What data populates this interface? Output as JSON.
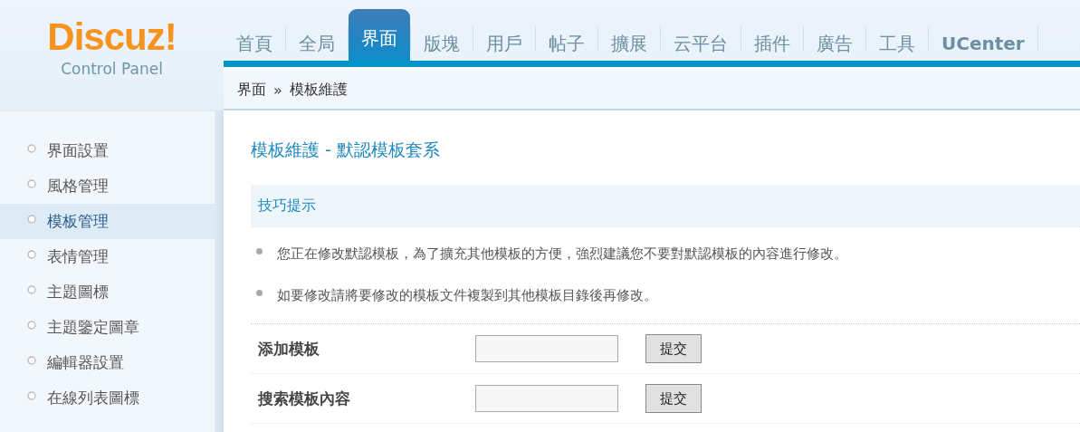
{
  "logo": {
    "brand": "Discuz!",
    "subtitle": "Control Panel"
  },
  "nav": [
    {
      "label": "首頁",
      "selected": false
    },
    {
      "label": "全局",
      "selected": false
    },
    {
      "label": "界面",
      "selected": true
    },
    {
      "label": "版塊",
      "selected": false
    },
    {
      "label": "用戶",
      "selected": false
    },
    {
      "label": "帖子",
      "selected": false
    },
    {
      "label": "擴展",
      "selected": false
    },
    {
      "label": "云平台",
      "selected": false
    },
    {
      "label": "插件",
      "selected": false
    },
    {
      "label": "廣告",
      "selected": false
    },
    {
      "label": "工具",
      "selected": false
    },
    {
      "label": "UCenter",
      "selected": false
    }
  ],
  "breadcrumb": {
    "parent": "界面",
    "separator": "»",
    "current": "模板維護"
  },
  "sidebar": [
    {
      "label": "界面設置",
      "selected": false
    },
    {
      "label": "風格管理",
      "selected": false
    },
    {
      "label": "模板管理",
      "selected": true
    },
    {
      "label": "表情管理",
      "selected": false
    },
    {
      "label": "主題圖標",
      "selected": false
    },
    {
      "label": "主題鑒定圖章",
      "selected": false
    },
    {
      "label": "編輯器設置",
      "selected": false
    },
    {
      "label": "在線列表圖標",
      "selected": false
    }
  ],
  "title": "模板維護 - 默認模板套系",
  "tips": {
    "heading": "技巧提示",
    "items": [
      "您正在修改默認模板，為了擴充其他模板的方便，強烈建議您不要對默認模板的內容進行修改。",
      "如要修改請將要修改的模板文件複製到其他模板目錄後再修改。"
    ]
  },
  "form": [
    {
      "label": "添加模板",
      "button": "提交"
    },
    {
      "label": "搜索模板內容",
      "button": "提交"
    }
  ]
}
